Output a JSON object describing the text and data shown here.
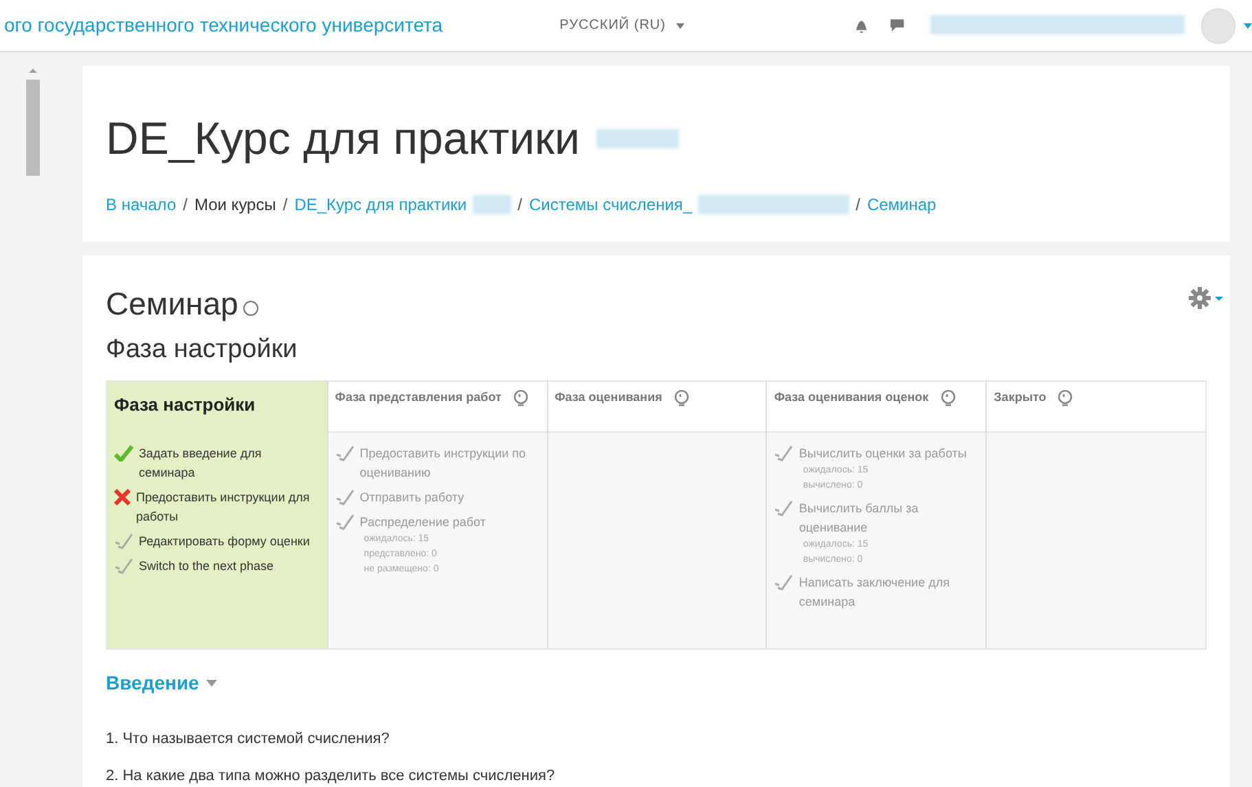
{
  "navbar": {
    "site_name": "ого государственного технического университета",
    "language": "РУССКИЙ (RU)"
  },
  "header": {
    "title": "DE_Курс для практики",
    "breadcrumbs": [
      {
        "text": "В начало",
        "link": true,
        "redacted": false
      },
      {
        "separator": "/",
        "text": "Мои курсы",
        "link": false,
        "redacted": false
      },
      {
        "separator": "/",
        "text": "DE_Курс для практики",
        "link": true,
        "redacted": true
      },
      {
        "separator": "/",
        "text": "Системы счисления_",
        "link": true,
        "redacted": true
      },
      {
        "separator": "/",
        "text": "Семинар",
        "link": true,
        "redacted": false
      }
    ]
  },
  "activity": {
    "title": "Семинар",
    "phase_heading": "Фаза настройки"
  },
  "phases": [
    {
      "title": "Фаза настройки",
      "selected": true,
      "tasks": [
        {
          "kind": "done",
          "text": "Задать введение для семинара"
        },
        {
          "kind": "fail",
          "text": "Предоставить инструкции для работы"
        },
        {
          "kind": "todo",
          "text": "Редактировать форму оценки"
        },
        {
          "kind": "todo",
          "text": "Switch to the next phase"
        }
      ]
    },
    {
      "title": "Фаза представления работ",
      "selected": false,
      "tasks": [
        {
          "kind": "todo",
          "text": "Предоставить инструкции по оцениванию"
        },
        {
          "kind": "todo",
          "text": "Отправить работу"
        },
        {
          "kind": "todo",
          "text": "Распределение работ",
          "details": [
            "ожидалось: 15",
            "представлено: 0",
            "не размещено: 0"
          ]
        }
      ]
    },
    {
      "title": "Фаза оценивания",
      "selected": false
    },
    {
      "title": "Фаза оценивания оценок",
      "selected": false,
      "tasks": [
        {
          "kind": "todo",
          "text": "Вычислить оценки за работы",
          "details": [
            "ожидалось: 15",
            "вычислено: 0"
          ]
        },
        {
          "kind": "todo",
          "text": "Вычислить баллы за оценивание",
          "details": [
            "ожидалось: 15",
            "вычислено: 0"
          ]
        },
        {
          "kind": "todo",
          "text": "Написать заключение для семинара"
        }
      ]
    },
    {
      "title": "Закрыто",
      "selected": false
    }
  ],
  "intro": {
    "heading": "Введение",
    "questions": [
      "1. Что называется системой счисления?",
      "2. На какие два типа можно разделить все системы счисления?"
    ]
  }
}
